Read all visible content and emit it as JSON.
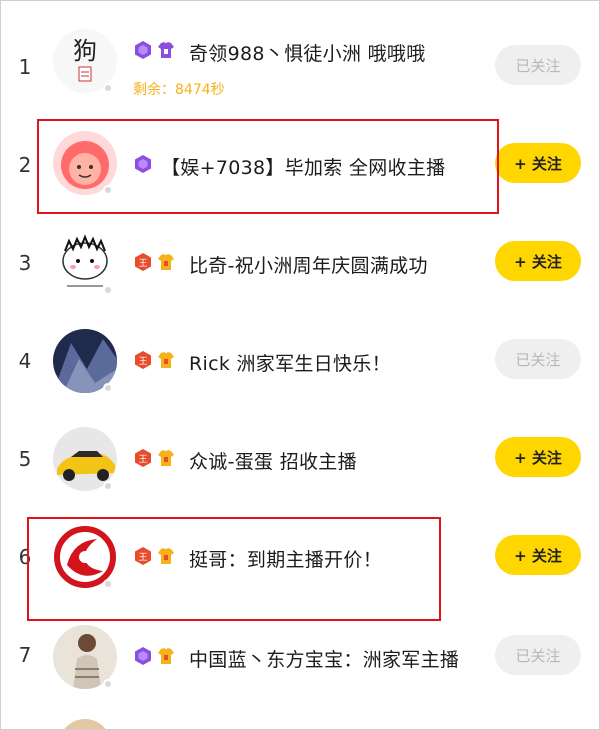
{
  "rows": [
    {
      "rank": "1",
      "name": "奇领988丶惧徒小洲 哦哦哦",
      "sub": "剩余：8474秒",
      "button": "已关注",
      "badges": [
        "purple-badge",
        "purple-shirt"
      ]
    },
    {
      "rank": "2",
      "name": "【娱+7038】毕加索 全网收主播",
      "button": "+ 关注",
      "badges": [
        "purple-badge"
      ]
    },
    {
      "rank": "3",
      "name": "比奇-祝小洲周年庆圆满成功",
      "button": "+ 关注",
      "badges": [
        "red-badge",
        "yellow-shirt"
      ]
    },
    {
      "rank": "4",
      "name": "Rick 洲家军生日快乐！",
      "button": "已关注",
      "badges": [
        "red-badge",
        "yellow-shirt"
      ]
    },
    {
      "rank": "5",
      "name": "众诚-蛋蛋 招收主播",
      "button": "+ 关注",
      "badges": [
        "red-badge",
        "yellow-shirt"
      ]
    },
    {
      "rank": "6",
      "name": "挺哥：到期主播开价！",
      "button": "+ 关注",
      "badges": [
        "red-badge",
        "yellow-shirt"
      ]
    },
    {
      "rank": "7",
      "name": "中国蓝丶东方宝宝：洲家军主播",
      "button": "已关注",
      "badges": [
        "purple-badge",
        "yellow-shirt"
      ]
    }
  ],
  "colors": {
    "follow_button": "#ffd600",
    "followed_button": "#efefef",
    "highlight_box": "#e2121b",
    "countdown": "#f5b21a"
  }
}
